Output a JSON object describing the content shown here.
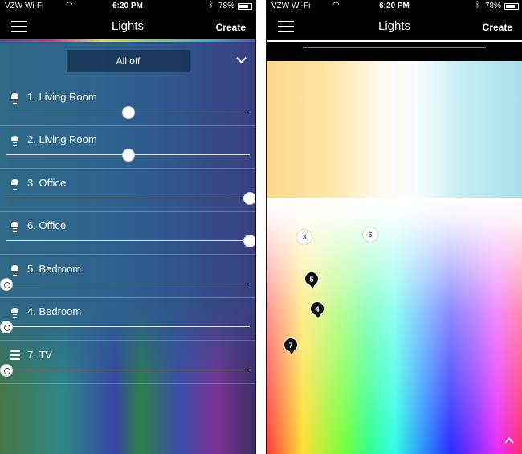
{
  "status_bar": {
    "carrier": "VZW Wi-Fi",
    "time": "6:20 PM",
    "battery": "78%"
  },
  "nav": {
    "title": "Lights",
    "create_label": "Create"
  },
  "controls": {
    "all_off_label": "All off"
  },
  "lights": [
    {
      "label": "1. Living Room",
      "icon": "bulb-icon",
      "brightness": 0.5,
      "on": true
    },
    {
      "label": "2. Living Room",
      "icon": "bulb-icon",
      "brightness": 0.5,
      "on": true
    },
    {
      "label": "3. Office",
      "icon": "bulb-icon",
      "brightness": 1.0,
      "on": true
    },
    {
      "label": "6. Office",
      "icon": "bulb-icon",
      "brightness": 1.0,
      "on": true
    },
    {
      "label": "5. Bedroom",
      "icon": "bulb-icon",
      "brightness": 0.0,
      "on": false
    },
    {
      "label": "4. Bedroom",
      "icon": "bulb-icon",
      "brightness": 0.0,
      "on": false
    },
    {
      "label": "7. TV",
      "icon": "lightstrip-icon",
      "brightness": 0.0,
      "on": false
    }
  ],
  "color_picker": {
    "pins": [
      {
        "label": "3",
        "style": "light"
      },
      {
        "label": "6",
        "style": "light"
      },
      {
        "label": "5",
        "style": "dark"
      },
      {
        "label": "4",
        "style": "dark"
      },
      {
        "label": "7",
        "style": "dark"
      }
    ]
  },
  "colors": {
    "header_bg": "#000000",
    "accent_track": "#ffffff"
  }
}
